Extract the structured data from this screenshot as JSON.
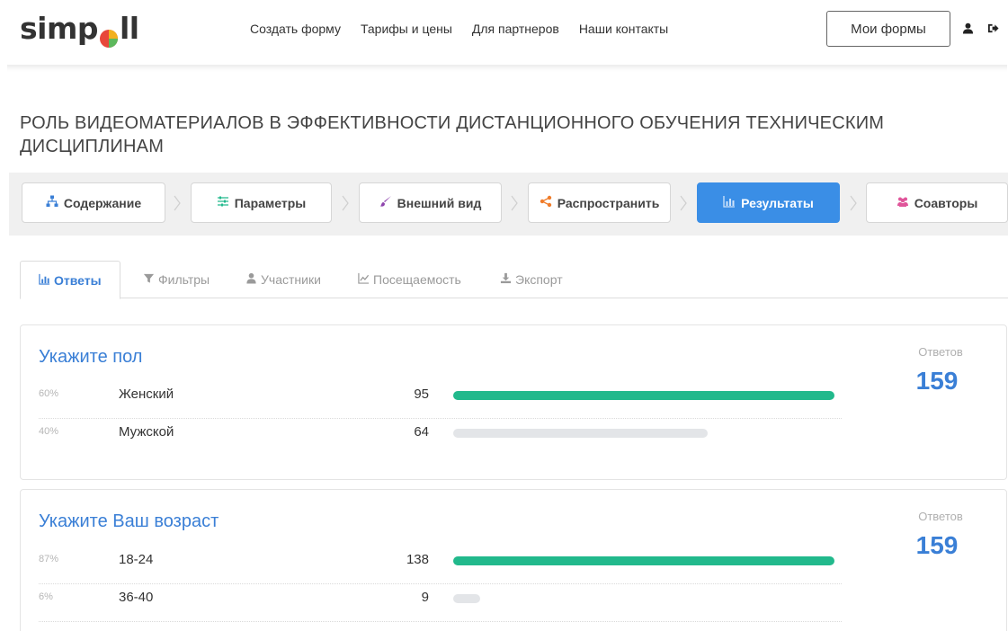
{
  "header": {
    "logo_text_left": "simp",
    "logo_text_right": "ll",
    "nav": [
      "Создать форму",
      "Тарифы и цены",
      "Для партнеров",
      "Наши контакты"
    ],
    "my_forms_label": "Мои формы",
    "icons": [
      "user-icon",
      "logout-icon"
    ]
  },
  "form": {
    "title": "РОЛЬ ВИДЕОМАТЕРИАЛОВ В ЭФФЕКТИВНОСТИ ДИСТАНЦИОННОГО ОБУЧЕНИЯ ТЕХНИЧЕСКИМ ДИСЦИПЛИНАМ"
  },
  "steps": [
    {
      "label": "Содержание",
      "icon": "sitemap-icon",
      "active": false
    },
    {
      "label": "Параметры",
      "icon": "sliders-icon",
      "active": false
    },
    {
      "label": "Внешний вид",
      "icon": "brush-icon",
      "active": false
    },
    {
      "label": "Распространить",
      "icon": "share-icon",
      "active": false
    },
    {
      "label": "Результаты",
      "icon": "bar-chart-icon",
      "active": true
    },
    {
      "label": "Соавторы",
      "icon": "users-icon",
      "active": false
    }
  ],
  "tabs": [
    {
      "label": "Ответы",
      "icon": "bar-chart-icon",
      "active": true
    },
    {
      "label": "Фильтры",
      "icon": "filter-icon",
      "active": false
    },
    {
      "label": "Участники",
      "icon": "user-icon",
      "active": false
    },
    {
      "label": "Посещаемость",
      "icon": "line-chart-icon",
      "active": false
    },
    {
      "label": "Экспорт",
      "icon": "download-icon",
      "active": false
    }
  ],
  "colors": {
    "accent": "#3a8ee6",
    "link": "#3a7fd6",
    "bar_primary": "#22b98c",
    "bar_secondary": "#e3e5e8"
  },
  "questions": [
    {
      "title": "Укажите пол",
      "responses_label": "Ответов",
      "responses_count": "159",
      "answers": [
        {
          "percent": "60%",
          "label": "Женский",
          "count": "95",
          "share": 0.6
        },
        {
          "percent": "40%",
          "label": "Мужской",
          "count": "64",
          "share": 0.4
        }
      ]
    },
    {
      "title": "Укажите Ваш возраст",
      "responses_label": "Ответов",
      "responses_count": "159",
      "answers": [
        {
          "percent": "87%",
          "label": "18-24",
          "count": "138",
          "share": 0.87
        },
        {
          "percent": "6%",
          "label": "36-40",
          "count": "9",
          "share": 0.06
        }
      ]
    }
  ]
}
